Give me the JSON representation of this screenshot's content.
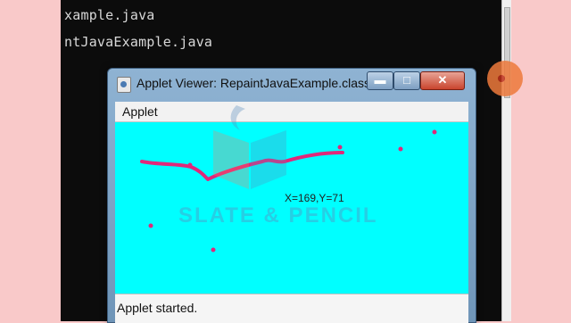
{
  "console": {
    "lines": [
      "xample.java",
      "ntJavaExample.java"
    ]
  },
  "window": {
    "title": "Applet Viewer: RepaintJavaExample.class",
    "controls": {
      "minimize": "▬",
      "maximize": "□",
      "close": "✕"
    },
    "menu": {
      "applet": "Applet"
    },
    "canvas": {
      "coords": "X=169,Y=71"
    },
    "status": "Applet started."
  },
  "watermark": {
    "text": "SLATE & PENCIL"
  },
  "colors": {
    "canvas_bg": "#00ffff",
    "stroke": "#e0287a",
    "console_bg": "#0c0c0c",
    "page_bg": "#f9c9c9"
  }
}
